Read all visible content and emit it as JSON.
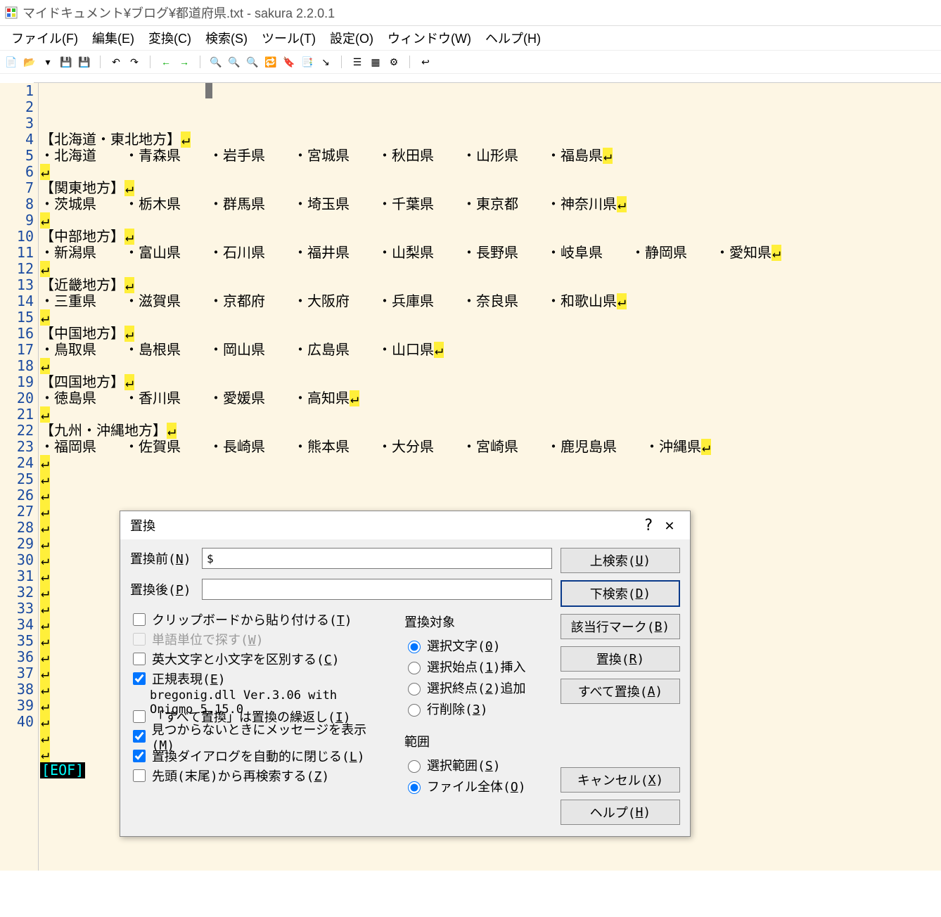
{
  "window": {
    "title": "マイドキュメント¥ブログ¥都道府県.txt - sakura 2.2.0.1"
  },
  "menubar": {
    "file": "ファイル(F)",
    "edit": "編集(E)",
    "convert": "変換(C)",
    "search": "検索(S)",
    "tool": "ツール(T)",
    "setting": "設定(O)",
    "window": "ウィンドウ(W)",
    "help": "ヘルプ(H)"
  },
  "editor": {
    "line_count": 40,
    "eof": "[EOF]",
    "lines": {
      "1": "【北海道・東北地方】",
      "2": "・北海道　　・青森県　　・岩手県　　・宮城県　　・秋田県　　・山形県　　・福島県",
      "3": "",
      "4": "【関東地方】",
      "5": "・茨城県　　・栃木県　　・群馬県　　・埼玉県　　・千葉県　　・東京都　　・神奈川県",
      "6": "",
      "7": "【中部地方】",
      "8": "・新潟県　　・富山県　　・石川県　　・福井県　　・山梨県　　・長野県　　・岐阜県　　・静岡県　　・愛知県",
      "9": "",
      "10": "【近畿地方】",
      "11": "・三重県　　・滋賀県　　・京都府　　・大阪府　　・兵庫県　　・奈良県　　・和歌山県",
      "12": "",
      "13": "【中国地方】",
      "14": "・鳥取県　　・島根県　　・岡山県　　・広島県　　・山口県",
      "15": "",
      "16": "【四国地方】",
      "17": "・徳島県　　・香川県　　・愛媛県　　・高知県",
      "18": "",
      "19": "【九州・沖縄地方】",
      "20": "・福岡県　　・佐賀県　　・長崎県　　・熊本県　　・大分県　　・宮崎県　　・鹿児島県　　・沖縄県"
    }
  },
  "dialog": {
    "title": "置換",
    "before_label": "置換前(",
    "before_key": "N",
    "after_label": "置換後(",
    "after_key": "P",
    "close_paren": ")",
    "before_value": "$",
    "after_value": "",
    "chk_clipboard": "クリップボードから貼り付ける(",
    "chk_clipboard_key": "T",
    "chk_word": "単語単位で探す(",
    "chk_word_key": "W",
    "chk_case": "英大文字と小文字を区別する(",
    "chk_case_key": "C",
    "chk_regex": "正規表現(",
    "chk_regex_key": "E",
    "regex_version": "bregonig.dll Ver.3.06 with Onigmo 5.15.0",
    "chk_repeat": "「すべて置換」は置換の繰返し(",
    "chk_repeat_key": "I",
    "chk_notfound": "見つからないときにメッセージを表示(",
    "chk_notfound_key": "M",
    "chk_autoclose": "置換ダイアログを自動的に閉じる(",
    "chk_autoclose_key": "L",
    "chk_wrap": "先頭(末尾)から再検索する(",
    "chk_wrap_key": "Z",
    "target_title": "置換対象",
    "target_sel": "選択文字(",
    "target_sel_key": "0",
    "target_ins": "選択始点(",
    "target_ins_key": "1",
    "target_ins_suffix": ")挿入",
    "target_add": "選択終点(",
    "target_add_key": "2",
    "target_add_suffix": ")追加",
    "target_del": "行削除(",
    "target_del_key": "3",
    "range_title": "範囲",
    "range_sel": "選択範囲(",
    "range_sel_key": "S",
    "range_file": "ファイル全体(",
    "range_file_key": "O",
    "btn_search_up": "上検索(",
    "btn_search_up_key": "U",
    "btn_search_down": "下検索(",
    "btn_search_down_key": "D",
    "btn_mark": "該当行マーク(",
    "btn_mark_key": "B",
    "btn_replace": "置換(",
    "btn_replace_key": "R",
    "btn_replace_all": "すべて置換(",
    "btn_replace_all_key": "A",
    "btn_cancel": "キャンセル(",
    "btn_cancel_key": "X",
    "btn_help": "ヘルプ(",
    "btn_help_key": "H"
  }
}
